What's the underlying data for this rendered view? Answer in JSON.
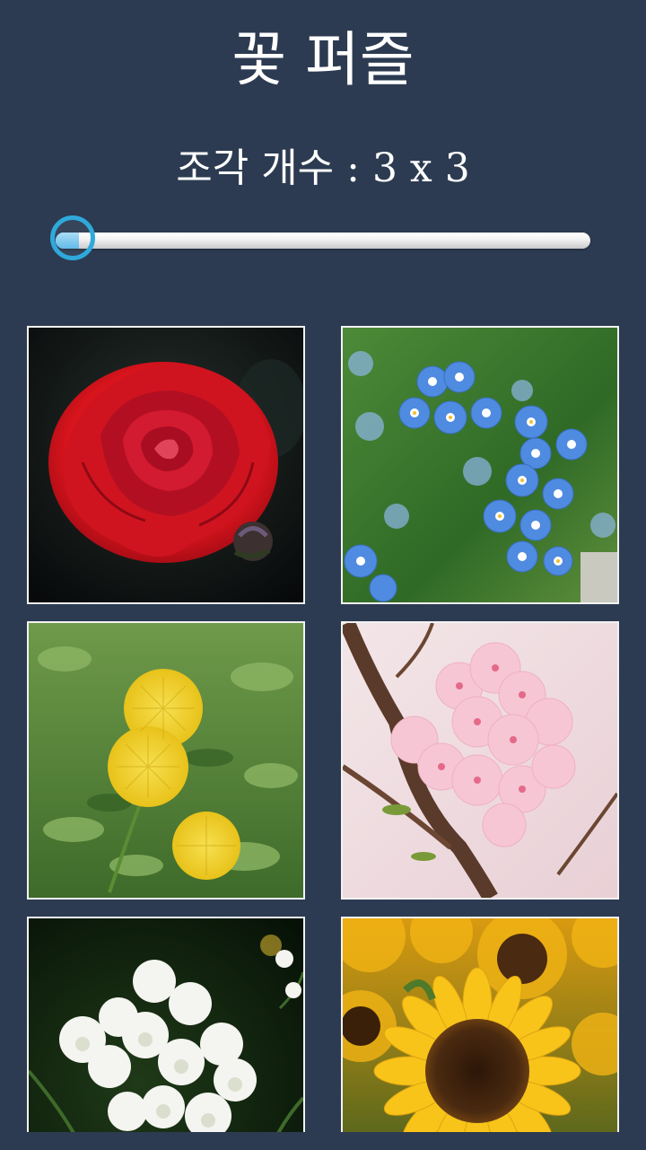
{
  "app": {
    "title": "꽃 퍼즐"
  },
  "settings": {
    "piece_count_label": "조각 개수 : 3 x 3",
    "slider": {
      "min": 3,
      "max": 10,
      "value": 3,
      "fraction": 0.0
    }
  },
  "gallery": {
    "items": [
      {
        "name": "rose",
        "icon": "rose-photo"
      },
      {
        "name": "forget-me-not",
        "icon": "forget-me-not-photo"
      },
      {
        "name": "dandelion",
        "icon": "dandelion-photo"
      },
      {
        "name": "cherry-blossom",
        "icon": "cherry-blossom-photo"
      },
      {
        "name": "white-wildflower",
        "icon": "white-wildflower-photo"
      },
      {
        "name": "sunflower",
        "icon": "sunflower-photo"
      }
    ]
  },
  "colors": {
    "background": "#2c3b51",
    "accent": "#2fa9dc",
    "text": "#ffffff",
    "tile_border": "#f2f2f2"
  }
}
